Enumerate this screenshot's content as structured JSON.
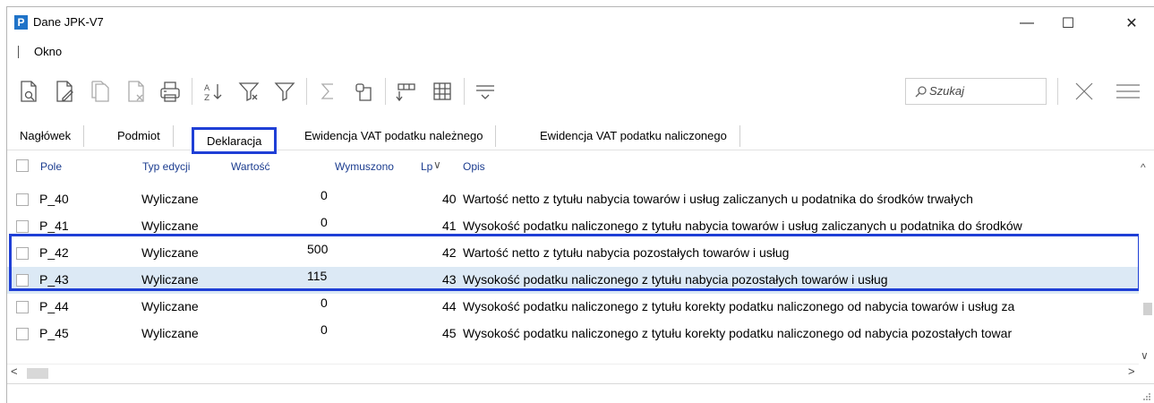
{
  "window": {
    "title": "Dane JPK-V7",
    "logo_letter": "P",
    "minimize_glyph": "—",
    "maximize_glyph": "☐",
    "close_glyph": "✕"
  },
  "menu": {
    "items": [
      {
        "label": "Okno"
      }
    ]
  },
  "toolbar": {
    "icons": [
      "preview-icon",
      "edit-icon",
      "copy-icon",
      "delete-icon",
      "print-icon",
      "sort-az-icon",
      "filter-clear-icon",
      "filter-icon",
      "sum-icon",
      "group-icon",
      "column-chooser-icon",
      "grid-icon",
      "details-icon"
    ],
    "search_placeholder": "Szukaj",
    "clear_icon": "close-icon",
    "menu_icon": "hamburger-icon"
  },
  "tabs": [
    {
      "label": "Nagłówek",
      "active": false
    },
    {
      "label": "Podmiot",
      "active": false
    },
    {
      "label": "Deklaracja",
      "active": true
    },
    {
      "label": "Ewidencja VAT podatku należnego",
      "active": false
    },
    {
      "label": "Ewidencja VAT podatku naliczonego",
      "active": false
    }
  ],
  "grid": {
    "columns": {
      "pole": "Pole",
      "typ": "Typ edycji",
      "wartosc": "Wartość",
      "wymuszono": "Wymuszono",
      "lp": "Lp",
      "opis": "Opis"
    },
    "sort_indicator": "∨",
    "rows": [
      {
        "pole": "P_40",
        "typ": "Wyliczane",
        "wartosc": "0",
        "lp": "40",
        "opis": "Wartość netto z tytułu nabycia towarów i usług zaliczanych u podatnika do środków trwałych",
        "selected": false
      },
      {
        "pole": "P_41",
        "typ": "Wyliczane",
        "wartosc": "0",
        "lp": "41",
        "opis": "Wysokość podatku naliczonego z tytułu nabycia towarów i usług zaliczanych u podatnika do środków",
        "selected": false
      },
      {
        "pole": "P_42",
        "typ": "Wyliczane",
        "wartosc": "500",
        "lp": "42",
        "opis": "Wartość netto z tytułu nabycia pozostałych towarów i usług",
        "selected": false
      },
      {
        "pole": "P_43",
        "typ": "Wyliczane",
        "wartosc": "115",
        "lp": "43",
        "opis": "Wysokość podatku naliczonego z tytułu nabycia pozostałych towarów i usług",
        "selected": true
      },
      {
        "pole": "P_44",
        "typ": "Wyliczane",
        "wartosc": "0",
        "lp": "44",
        "opis": "Wysokość podatku naliczonego z tytułu korekty podatku naliczonego od nabycia towarów i usług za",
        "selected": false
      },
      {
        "pole": "P_45",
        "typ": "Wyliczane",
        "wartosc": "0",
        "lp": "45",
        "opis": "Wysokość podatku naliczonego z tytułu korekty podatku naliczonego od nabycia pozostałych towar",
        "selected": false
      }
    ]
  },
  "scroll": {
    "up": "^",
    "down": "∨",
    "left": "<",
    "right": ">"
  },
  "colors": {
    "highlight_border": "#1f3fd6",
    "selected_row": "#dce9f5",
    "header_text": "#1b3c8f",
    "logo": "#1f73c8"
  }
}
